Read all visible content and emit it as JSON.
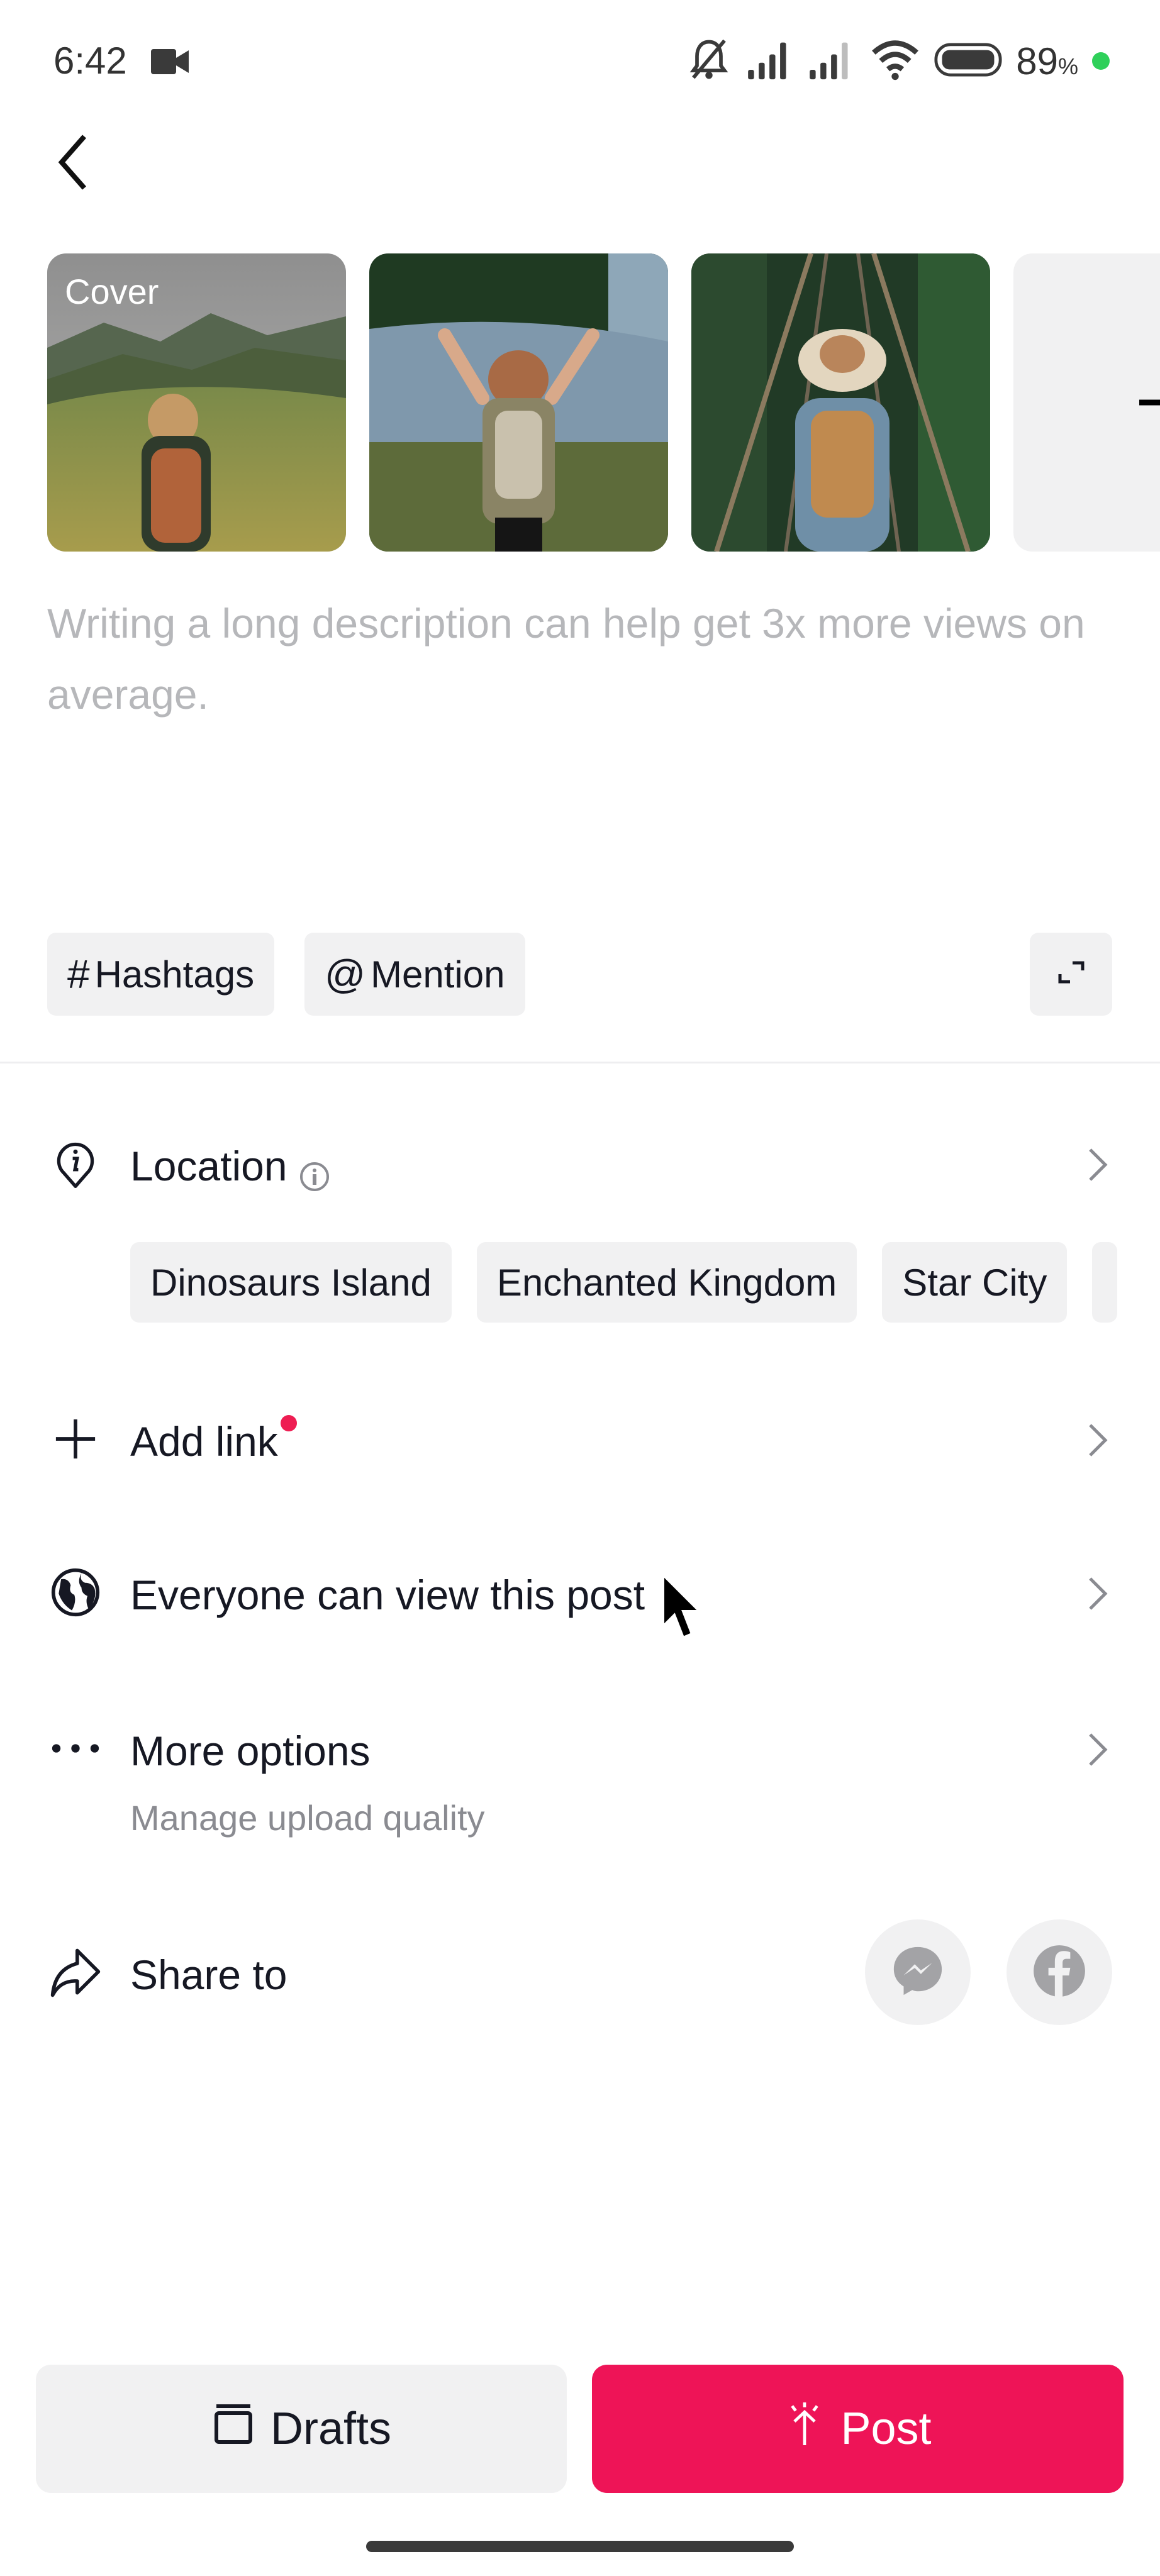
{
  "status_bar": {
    "time": "6:42",
    "battery_percent": "89",
    "battery_percent_sign": "%",
    "icons": [
      "video-record-icon",
      "mute-bell-icon",
      "signal-icon",
      "signal-weak-icon",
      "wifi-icon",
      "battery-icon"
    ],
    "battery_dot_color": "#2fd05a"
  },
  "header": {
    "back_icon": "chevron-left-icon"
  },
  "media": {
    "items": [
      {
        "label": "Cover",
        "description": "hiker with orange backpack in mountain meadow"
      },
      {
        "label": "",
        "description": "hiker with arms raised at waterfall"
      },
      {
        "label": "",
        "description": "hiker on rope suspension bridge in jungle"
      }
    ],
    "add_icon": "plus-icon"
  },
  "description": {
    "placeholder": "Writing a long description can help get 3x more views on average."
  },
  "composer_tools": {
    "hashtags": {
      "symbol": "#",
      "label": "Hashtags"
    },
    "mention": {
      "symbol": "@",
      "label": "Mention"
    },
    "expand_icon": "expand-icon"
  },
  "location": {
    "label": "Location",
    "suggestions": [
      "Dinosaurs Island",
      "Enchanted Kingdom",
      "Star City"
    ]
  },
  "add_link": {
    "label": "Add link",
    "dot_color": "#ee1d52"
  },
  "visibility": {
    "label": "Everyone can view this post"
  },
  "more_options": {
    "label": "More options",
    "subtitle": "Manage upload quality"
  },
  "share": {
    "label": "Share to",
    "targets": [
      "Messenger",
      "Facebook"
    ]
  },
  "actions": {
    "drafts_label": "Drafts",
    "post_label": "Post",
    "post_color": "#ee1457"
  }
}
